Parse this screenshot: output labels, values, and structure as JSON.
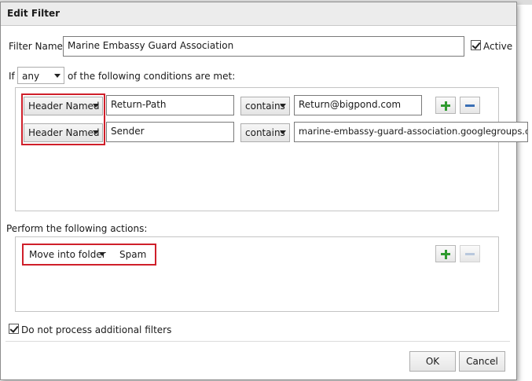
{
  "dialog": {
    "title": "Edit Filter"
  },
  "filter_name": {
    "label": "Filter Name:",
    "value": "Marine Embassy Guard Association"
  },
  "active": {
    "label": "Active",
    "checked": true
  },
  "match": {
    "prefix": "If",
    "selected": "any",
    "suffix": "of the following conditions are met:"
  },
  "conditions": [
    {
      "field": "Header Named",
      "header": "Return-Path",
      "operator": "contains",
      "value": "Return@bigpond.com"
    },
    {
      "field": "Header Named",
      "header": "Sender",
      "operator": "contains",
      "value": "marine-embassy-guard-association.googlegroups.com"
    }
  ],
  "actions_label": "Perform the following actions:",
  "actions": [
    {
      "type": "Move into folder",
      "folder": "Spam"
    }
  ],
  "stop_processing": {
    "label": "Do not process additional filters",
    "checked": true
  },
  "buttons": {
    "ok": "OK",
    "cancel": "Cancel"
  },
  "icons": {
    "add": "plus-icon",
    "remove": "minus-icon"
  },
  "colors": {
    "highlight": "#cf1f2a",
    "add_icon": "#2f9a2f",
    "remove_icon": "#3a6fb5"
  }
}
